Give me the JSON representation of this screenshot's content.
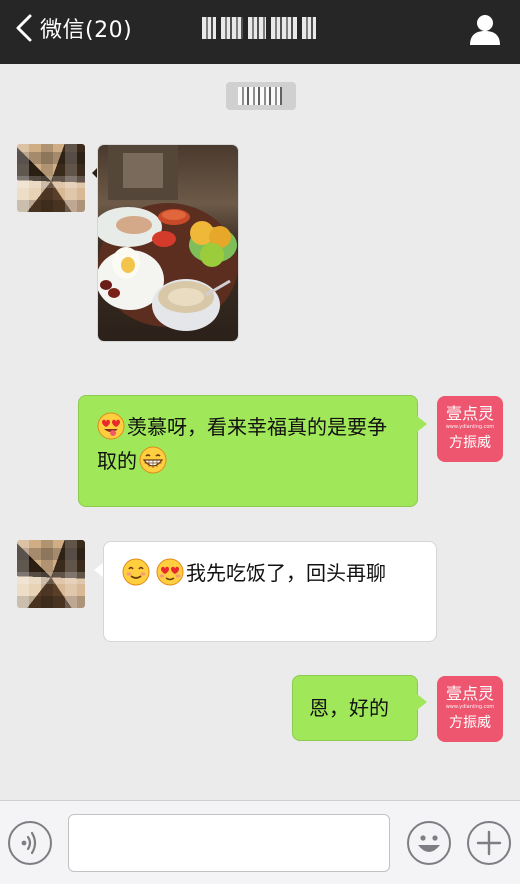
{
  "header": {
    "back_label": "微信(20)",
    "contact_name_censored": true
  },
  "messages": [
    {
      "side": "left",
      "type": "image"
    },
    {
      "side": "right",
      "type": "text",
      "text": "羡慕呀，看来幸福真的是要争取的",
      "emoji_before": "heart-eyes-tongue-emoji",
      "emoji_after": "grin-emoji"
    },
    {
      "side": "left",
      "type": "text",
      "text": "我先吃饭了，回头再聊",
      "emoji_before": [
        "smile-emoji",
        "heart-eyes-emoji"
      ]
    },
    {
      "side": "right",
      "type": "text",
      "text": "恩，好的"
    }
  ],
  "my_avatar": {
    "line1": "壹点灵",
    "line2": "www.ydianling.com",
    "line3": "方振威"
  },
  "colors": {
    "header_bg": "#262626",
    "chat_bg": "#ebebeb",
    "bubble_sent": "#a0e75a",
    "bubble_received": "#ffffff",
    "avatar_brand": "#ee5670"
  },
  "inputbar": {
    "voice_icon": "voice-icon",
    "emoji_icon": "emoji-icon",
    "plus_icon": "plus-icon",
    "placeholder": ""
  }
}
